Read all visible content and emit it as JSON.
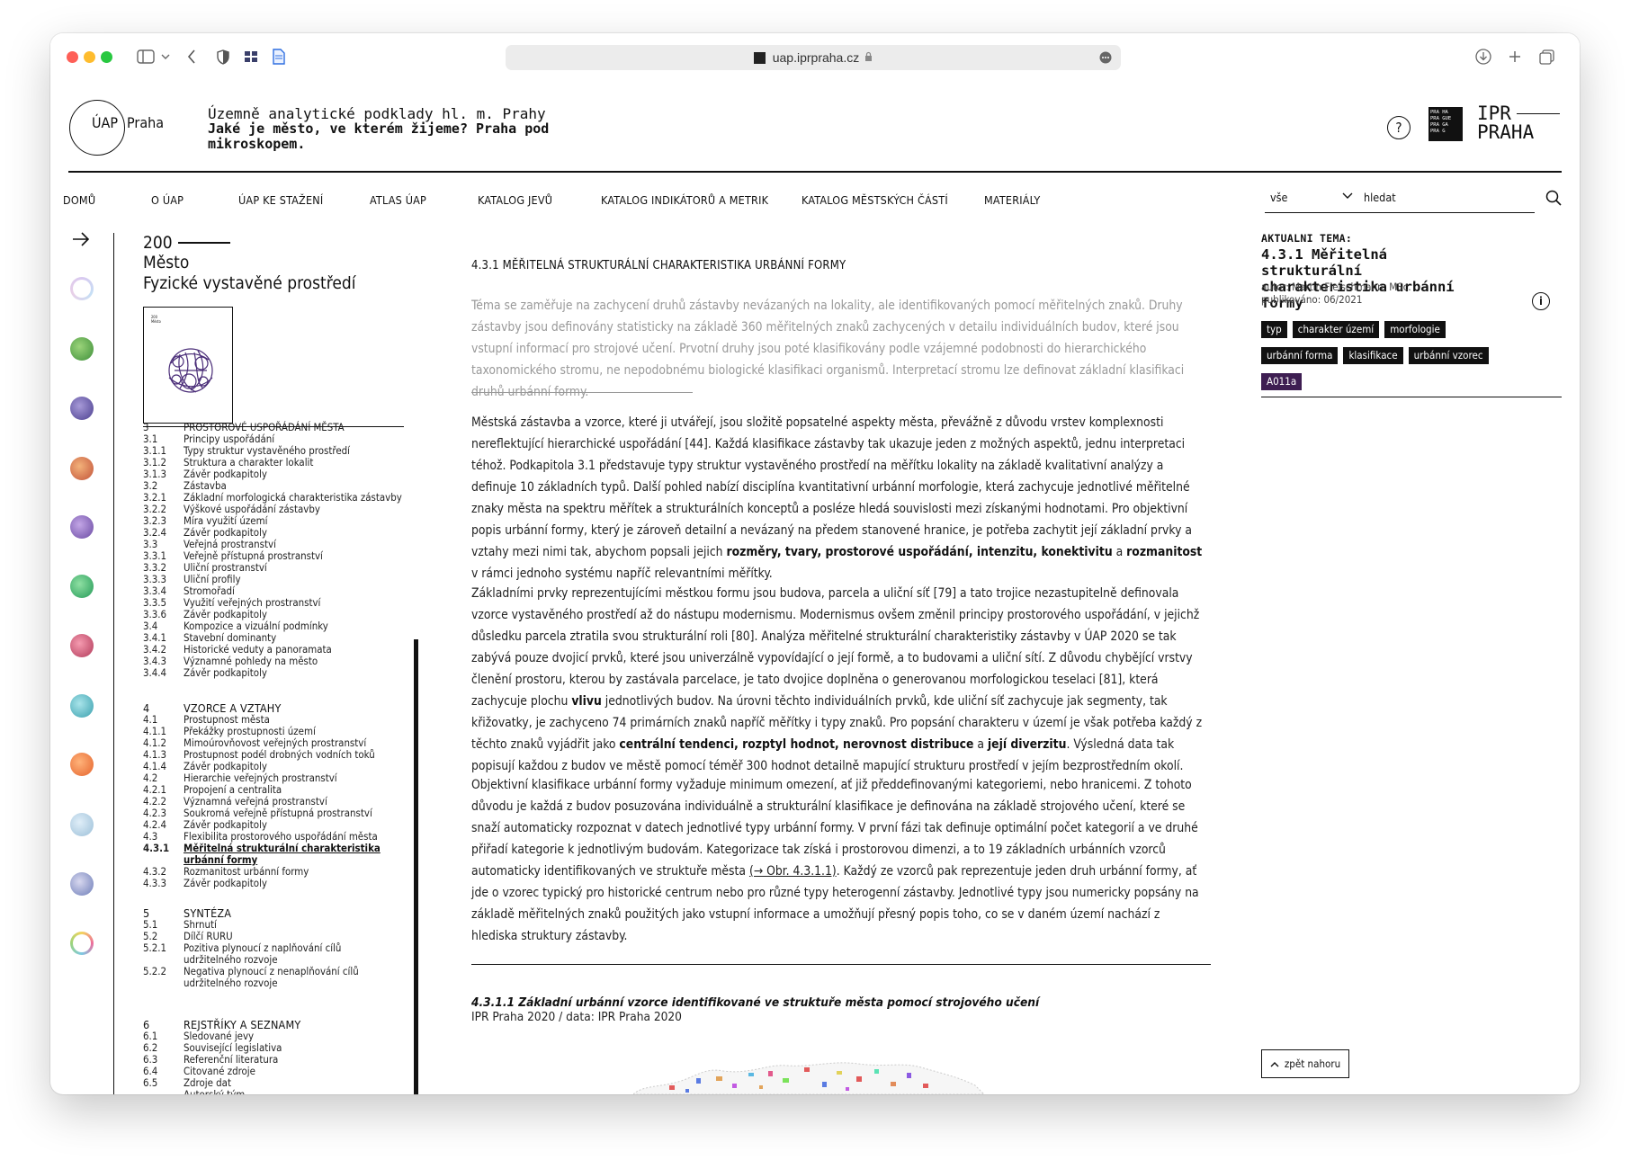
{
  "browser": {
    "url": "uap.iprpraha.cz"
  },
  "site": {
    "logo_uap": "ÚAP",
    "logo_praha": "Praha",
    "subtitle": "Územně analytické podklady hl. m. Prahy",
    "title": "Jaké je město, ve kterém žijeme? Praha pod mikroskopem.",
    "help": "?",
    "prague_badge": [
      "PRA HA",
      "PRA GUE",
      "PRA GA",
      "PRA G"
    ],
    "ipr_line1": "IPR",
    "ipr_line2": "PRAHA"
  },
  "nav": {
    "items": [
      "DOMŮ",
      "O ÚAP",
      "ÚAP KE STAŽENÍ",
      "ATLAS ÚAP",
      "KATALOG JEVŮ",
      "KATALOG INDIKÁTORŮ A METRIK",
      "KATALOG MĚSTSKÝCH ČÁSTÍ",
      "MATERIÁLY"
    ],
    "search_scope": "vše",
    "search_placeholder": "hledat"
  },
  "sidebar": {
    "number": "200",
    "heading_line1": "Město",
    "heading_line2": "Fyzické vystavěné prostředí",
    "cover_number": "200",
    "cover_title": "Město",
    "toc": [
      {
        "n": "3",
        "t": "PROSTOROVÉ USPOŘÁDÁNÍ MĚSTA"
      },
      {
        "n": "3.1",
        "t": "Principy uspořádání"
      },
      {
        "n": "3.1.1",
        "t": "Typy struktur vystavěného prostředí"
      },
      {
        "n": "3.1.2",
        "t": "Struktura a charakter lokalit"
      },
      {
        "n": "3.1.3",
        "t": "Závěr podkapitoly"
      },
      {
        "n": "3.2",
        "t": "Zástavba"
      },
      {
        "n": "3.2.1",
        "t": "Základní morfologická charakteristika zástavby"
      },
      {
        "n": "3.2.2",
        "t": "Výškové uspořádání zástavby"
      },
      {
        "n": "3.2.3",
        "t": "Míra využití území"
      },
      {
        "n": "3.2.4",
        "t": "Závěr podkapitoly"
      },
      {
        "n": "3.3",
        "t": "Veřejná prostranství"
      },
      {
        "n": "3.3.1",
        "t": "Veřejně přístupná prostranství"
      },
      {
        "n": "3.3.2",
        "t": "Uliční prostranství"
      },
      {
        "n": "3.3.3",
        "t": "Uliční profily"
      },
      {
        "n": "3.3.4",
        "t": "Stromořadí"
      },
      {
        "n": "3.3.5",
        "t": "Využití veřejných prostranství"
      },
      {
        "n": "3.3.6",
        "t": "Závěr podkapitoly"
      },
      {
        "n": "3.4",
        "t": "Kompozice a vizuální podmínky"
      },
      {
        "n": "3.4.1",
        "t": "Stavební dominanty"
      },
      {
        "n": "3.4.2",
        "t": "Historické veduty a panoramata"
      },
      {
        "n": "3.4.3",
        "t": "Významné pohledy na město"
      },
      {
        "n": "3.4.4",
        "t": "Závěr podkapitoly"
      }
    ],
    "toc4_head": {
      "n": "4",
      "t": "VZORCE A VZTAHY"
    },
    "toc4": [
      {
        "n": "4.1",
        "t": "Prostupnost města"
      },
      {
        "n": "4.1.1",
        "t": "Překážky prostupnosti území"
      },
      {
        "n": "4.1.2",
        "t": "Mimoúrovňovost veřejných prostranství"
      },
      {
        "n": "4.1.3",
        "t": "Prostupnost podél drobných vodních toků"
      },
      {
        "n": "4.1.4",
        "t": "Závěr podkapitoly"
      },
      {
        "n": "4.2",
        "t": "Hierarchie veřejných prostranství"
      },
      {
        "n": "4.2.1",
        "t": "Propojení a centralita"
      },
      {
        "n": "4.2.2",
        "t": "Významná veřejná prostranství"
      },
      {
        "n": "4.2.3",
        "t": "Soukromá veřejně přístupná prostranství"
      },
      {
        "n": "4.2.4",
        "t": "Závěr podkapitoly"
      },
      {
        "n": "4.3",
        "t": "Flexibilita prostorového uspořádání města"
      },
      {
        "n": "4.3.1",
        "t": "Měřitelná strukturální charakteristika",
        "t2": "urbánní formy",
        "current": true
      },
      {
        "n": "4.3.2",
        "t": "Rozmanitost urbánní formy"
      },
      {
        "n": "4.3.3",
        "t": "Závěr podkapitoly"
      }
    ],
    "toc5_head": {
      "n": "5",
      "t": "SYNTÉZA"
    },
    "toc5": [
      {
        "n": "5.1",
        "t": "Shrnutí"
      },
      {
        "n": "5.2",
        "t": "Dílčí RURU"
      },
      {
        "n": "5.2.1",
        "t": "Pozitiva plynoucí z naplňování cílů",
        "t2": "udržitelného rozvoje"
      },
      {
        "n": "5.2.2",
        "t": "Negativa plynoucí z nenaplňování cílů",
        "t2": "udržitelného rozvoje"
      }
    ],
    "toc6_head": {
      "n": "6",
      "t": "REJSTŘÍKY A SEZNAMY"
    },
    "toc6": [
      {
        "n": "6.1",
        "t": "Sledované jevy"
      },
      {
        "n": "6.2",
        "t": "Související legislativa"
      },
      {
        "n": "6.3",
        "t": "Referenční literatura"
      },
      {
        "n": "6.4",
        "t": "Citované zdroje"
      },
      {
        "n": "6.5",
        "t": "Zdroje dat"
      },
      {
        "n": "",
        "t": "Autorský tým"
      }
    ]
  },
  "main": {
    "title": "4.3.1 MĚŘITELNÁ STRUKTURÁLNÍ CHARAKTERISTIKA URBÁNNÍ FORMY",
    "lead": "Téma se zaměřuje na zachycení druhů zástavby nevázaných na lokality, ale identifikovaných pomocí měřitelných znaků. Druhy zástavby jsou definovány statisticky na základě 360 měřitelných znaků zachycených v detailu individuálních budov, které jsou vstupní informací pro strojové učení. Prvotní druhy jsou poté klasifikovány podle vzájemné podobnosti do hierarchického taxonomického stromu, ne nepodobnému biologické klasifikaci organismů. Interpretací stromu lze definovat základní klasifikaci druhů urbánní formy.",
    "p1_a": "Městská zástavba a vzorce, které ji utvářejí, jsou složitě popsatelné aspekty města, převážně z důvodu vrstev komplexnosti nereflektující hierarchické uspořádání [44]. Každá klasifikace zástavby tak ukazuje jeden z možných aspektů, jednu interpretaci téhož. Podkapitola 3.1 představuje typy struktur vystavěného prostředí na měřítku lokality na základě kvalitativní analýzy a definuje 10 základních typů. Další pohled nabízí disciplína kvantitativní urbánní morfologie, která zachycuje jednotlivé měřitelné znaky města na spektru měřítek a strukturálních konceptů a posléze hledá souvislosti mezi získanými hodnotami. Pro objektivní popis urbánní formy, který je zároveň detailní a nevázaný na předem stanovené hranice, je potřeba zachytit její základní prvky a vztahy mezi nimi tak, abychom popsali jejich ",
    "p1_b": "rozměry, tvary, prostorové uspořádání, intenzitu, konektivitu",
    "p1_c": " a ",
    "p1_d": "rozmanitost",
    "p1_e": " v rámci jednoho systému napříč relevantními měřítky.",
    "p2_a": "Základními prvky reprezentujícími městkou formu jsou budova, parcela a uliční síť [79] a tato trojice nezastupitelně definovala vzorce vystavěného prostředí až do nástupu modernismu. Modernismus ovšem změnil principy prostorového uspořádání, v jejichž důsledku parcela ztratila svou strukturální roli [80]. Analýza měřitelné strukturální charakteristiky zástavby v ÚAP 2020 se tak zabývá pouze dvojicí prvků, které jsou univerzálně vypovídající o její formě, a to budovami a uliční sítí. Z důvodu chybějící vrstvy členění prostoru, kterou by zastávala parcelace, je tato dvojice doplněna o generovanou morfologickou teselaci [81], která zachycuje plochu ",
    "p2_b": "vlivu",
    "p2_c": " jednotlivých budov. Na úrovni těchto individuálních prvků, kde uliční síť zachycuje jak segmenty, tak křižovatky, je zachyceno 74 primárních znaků napříč měřítky i typy znaků. Pro popsání charakteru v území je však potřeba každý z těchto znaků vyjádřit jako ",
    "p2_d": "centrální tendenci, rozptyl hodnot, nerovnost distribuce",
    "p2_e": " a ",
    "p2_f": "její diverzitu",
    "p2_g": ". Výsledná data tak popisují každou z budov ve městě pomocí téměř 300 hodnot detailně mapující strukturu prostředí v jejím bezprostředním okolí.",
    "p3_a": "Objektivní klasifikace urbánní formy vyžaduje minimum omezení, ať již předdefinovanými kategoriemi, nebo hranicemi. Z tohoto důvodu je každá z budov posuzována individuálně a strukturální klasifikace je definována na základě strojového učení, které se snaží automaticky rozpoznat v datech jednotlivé typy urbánní formy. V první fázi tak definuje optimální počet kategorií a ve druhé přiřadí kategorie k jednotlivým budovám. Kategorizace tak získá i prostorovou dimenzi, a to 19 základních urbánních vzorců automaticky identifikovaných ve struktuře města ",
    "p3_ref": "(→ Obr. 4.3.1.1)",
    "p3_b": ". Každý ze vzorců pak reprezentuje jeden druh urbánní formy, ať jde o vzorec typický pro historické centrum nebo pro různé typy heterogenní zástavby. Jednotlivé typy jsou numericky popsány na základě měřitelných znaků použitých jako vstupní informace a umožňují přesný popis toho, co se v daném území nachází z hlediska struktury zástavby.",
    "fig_title": "4.3.1.1 Základní urbánní vzorce identifikované ve struktuře města pomocí strojového učení",
    "fig_source": "IPR Praha 2020 / data: IPR Praha 2020"
  },
  "right": {
    "label": "AKTUALNI TEMA:",
    "title": "4.3.1 Měřitelná strukturální charakteristika urbánní formy",
    "author": "autor: Martin Fleischmann, MSc.",
    "published": "publikováno: 06/2021",
    "info": "i",
    "tags": [
      "typ",
      "charakter území",
      "morfologie",
      "urbánní forma",
      "klasifikace",
      "urbánní vzorec"
    ],
    "code_tag": "A011a",
    "back_to_top": "zpět nahoru"
  },
  "colors": {
    "accent": "#3e1e52",
    "text": "#111111",
    "muted": "#999999"
  }
}
